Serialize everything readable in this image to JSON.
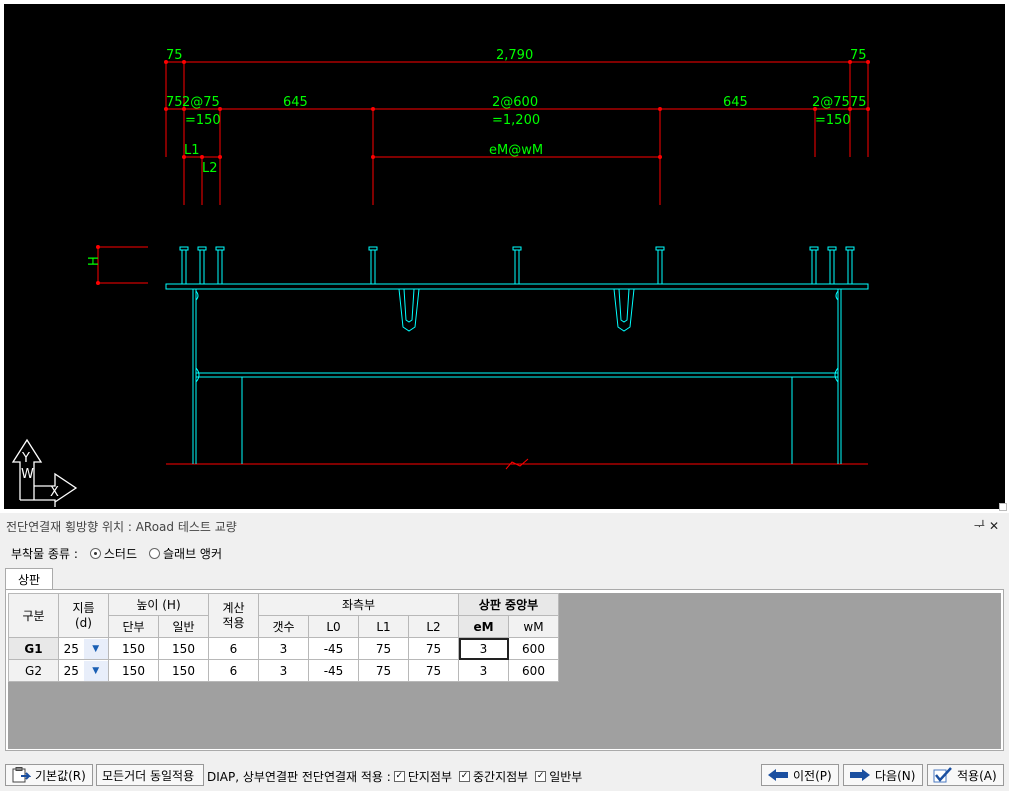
{
  "drawing": {
    "dims_top": {
      "left": "75",
      "total": "2,790",
      "right": "75"
    },
    "dims_row2": {
      "l_75": "75",
      "l_2at75": "2@75",
      "l_150": "=150",
      "d645a": "645",
      "d2at600": "2@600",
      "d1200": "=1,200",
      "d645b": "645",
      "r_2at75": "2@75",
      "r_75": "75",
      "r_150": "=150"
    },
    "labels": {
      "L1": "L1",
      "L2": "L2",
      "eMwM": "eM@wM",
      "H": "H",
      "axisY": "Y",
      "axisW": "W",
      "axisX": "X"
    },
    "colors": {
      "dim": "#ff0000",
      "text": "#00ff00",
      "geom": "#00ffff",
      "ground": "#ff0000"
    }
  },
  "panel": {
    "title": "전단연결재 횡방향 위치 : ARoad 테스트 교량",
    "controls": "ᆛ ✕"
  },
  "attachment": {
    "label": "부착물 종류 :",
    "options": [
      {
        "label": "스터드",
        "selected": true
      },
      {
        "label": "슬래브 앵커",
        "selected": false
      }
    ]
  },
  "tab": {
    "label": "상판"
  },
  "grid": {
    "headers": {
      "gubun": "구분",
      "dia": "지름\n(d)",
      "height": "높이 (H)",
      "h_end": "단부",
      "h_gen": "일반",
      "calc": "계산\n적용",
      "left": "좌측부",
      "count": "갯수",
      "l0": "L0",
      "l1": "L1",
      "l2": "L2",
      "center": "상판 중앙부",
      "em": "eM",
      "wm": "wM"
    },
    "rows": [
      {
        "name": "G1",
        "dia": "25",
        "h_end": "150",
        "h_gen": "150",
        "calc": "6",
        "count": "3",
        "l0": "-45",
        "l1": "75",
        "l2": "75",
        "em": "3",
        "wm": "600"
      },
      {
        "name": "G2",
        "dia": "25",
        "h_end": "150",
        "h_gen": "150",
        "calc": "6",
        "count": "3",
        "l0": "-45",
        "l1": "75",
        "l2": "75",
        "em": "3",
        "wm": "600"
      }
    ]
  },
  "footer": {
    "default_btn": "기본값(R)",
    "all_girders_btn": "모든거더 동일적용",
    "apply_text": "DIAP, 상부연결판 전단연결재 적용 :",
    "checks": [
      {
        "label": "단지점부",
        "checked": true
      },
      {
        "label": "중간지점부",
        "checked": true
      },
      {
        "label": "일반부",
        "checked": true
      }
    ],
    "prev_btn": "이전(P)",
    "next_btn": "다음(N)",
    "apply_btn": "적용(A)"
  }
}
